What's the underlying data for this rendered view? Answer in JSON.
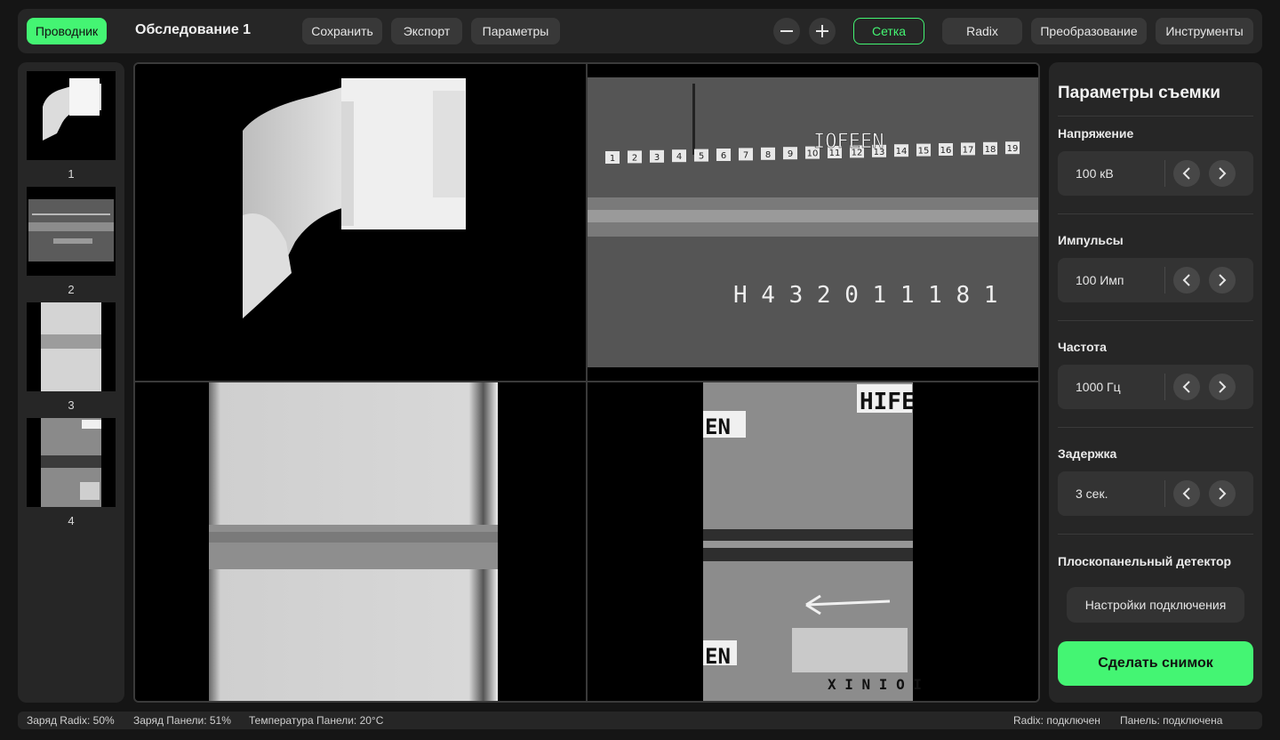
{
  "header": {
    "explorer_label": "Проводник",
    "title": "Обследование 1",
    "save_label": "Сохранить",
    "export_label": "Экспорт",
    "params_label": "Параметры",
    "grid_label": "Сетка",
    "radix_label": "Radix",
    "transform_label": "Преобразование",
    "tools_label": "Инструменты"
  },
  "thumbnails": [
    {
      "label": "1"
    },
    {
      "label": "2"
    },
    {
      "label": "3"
    },
    {
      "label": "4"
    }
  ],
  "viewer": {
    "image2_top_markers": [
      "1",
      "2",
      "3",
      "4",
      "5",
      "6",
      "7",
      "8",
      "9",
      "10",
      "11",
      "12",
      "13",
      "14",
      "15",
      "16",
      "17",
      "18",
      "19"
    ],
    "image2_top_label": "IOFEEN",
    "image2_bottom_label": "H 4 3 2 0 1 1 1 8 1",
    "image4_label_top": "HIFE",
    "image4_label_left": "EN",
    "image4_label_left2": "EN",
    "image4_codes": "X I N I O I"
  },
  "panel": {
    "title": "Параметры съемки",
    "params": [
      {
        "label": "Напряжение",
        "value": "100 кВ"
      },
      {
        "label": "Импульсы",
        "value": "100 Имп"
      },
      {
        "label": "Частота",
        "value": "1000 Гц"
      },
      {
        "label": "Задержка",
        "value": "3 сек."
      }
    ],
    "detector_label": "Плоскопанельный детектор",
    "connection_button": "Настройки подключения",
    "capture_button": "Сделать снимок"
  },
  "status": {
    "radix_charge": "Заряд Radix: 50%",
    "panel_charge": "Заряд Панели: 51%",
    "panel_temp": "Температура Панели: 20°C",
    "radix_state": "Radix: подключен",
    "panel_state": "Панель: подключена"
  },
  "colors": {
    "accent": "#44f573",
    "background": "#151515",
    "surface": "#262626"
  }
}
